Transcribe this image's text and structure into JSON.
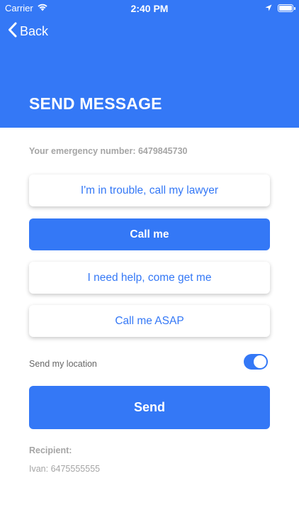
{
  "status_bar": {
    "carrier": "Carrier",
    "time": "2:40 PM"
  },
  "nav": {
    "back_label": "Back",
    "title": "SEND MESSAGE"
  },
  "emergency_number_text": "Your emergency number: 6479845730",
  "message_options": [
    {
      "label": "I'm in trouble, call my lawyer",
      "selected": false
    },
    {
      "label": "Call me",
      "selected": true
    },
    {
      "label": "I need help, come get me",
      "selected": false
    },
    {
      "label": "Call me ASAP",
      "selected": false
    }
  ],
  "location": {
    "label": "Send my location",
    "enabled": true
  },
  "send_button_label": "Send",
  "recipient": {
    "heading": "Recipient:",
    "value": "Ivan: 6475555555"
  },
  "colors": {
    "accent": "#3478f6",
    "muted_text": "#a5a5a5"
  }
}
